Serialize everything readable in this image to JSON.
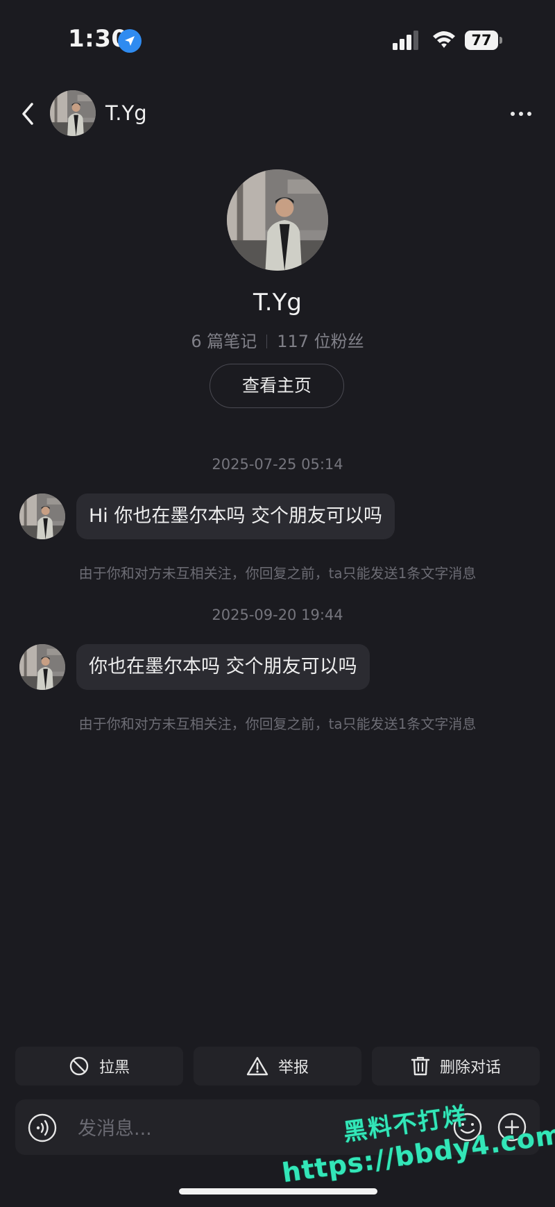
{
  "status_bar": {
    "time": "1:30",
    "battery": "77"
  },
  "header": {
    "name": "T.Yg"
  },
  "profile": {
    "name": "T.Yg",
    "notes": "6 篇笔记",
    "fans": "117 位粉丝",
    "homepage_button": "查看主页"
  },
  "messages": [
    {
      "timestamp": "2025-07-25 05:14",
      "text": "Hi 你也在墨尔本吗 交个朋友可以吗",
      "notice": "由于你和对方未互相关注，你回复之前，ta只能发送1条文字消息"
    },
    {
      "timestamp": "2025-09-20 19:44",
      "text": "你也在墨尔本吗 交个朋友可以吗",
      "notice": "由于你和对方未互相关注，你回复之前，ta只能发送1条文字消息"
    }
  ],
  "actions": {
    "block": "拉黑",
    "report": "举报",
    "delete": "删除对话"
  },
  "input": {
    "placeholder": "发消息..."
  },
  "watermark": {
    "line1": "黑料不打烊",
    "line2": "https://bbdy4.com"
  },
  "icons": [
    "location-arrow-icon",
    "signal-icon",
    "wifi-icon",
    "battery-icon",
    "back-chevron-icon",
    "more-dots-icon",
    "block-icon",
    "warning-icon",
    "trash-icon",
    "voice-icon",
    "emoji-icon",
    "plus-icon"
  ]
}
